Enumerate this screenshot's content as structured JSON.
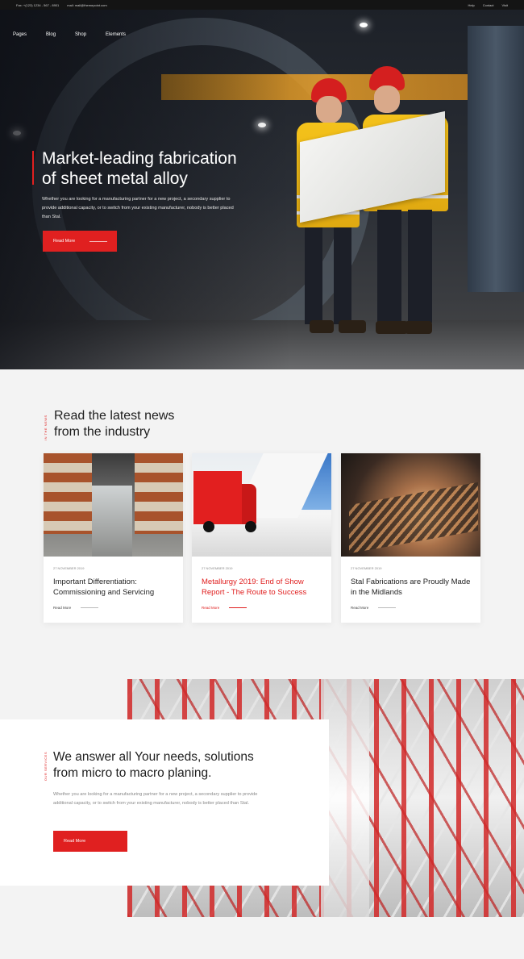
{
  "topbar": {
    "phone": "Fax: +(123) 1234 - 567 - 8901",
    "email": "mail: mail@themepoint.com",
    "links": [
      "Help",
      "Contact",
      "Visit"
    ]
  },
  "nav": [
    "Pages",
    "Blog",
    "Shop",
    "Elements"
  ],
  "hero": {
    "title_line1": "Market-leading fabrication",
    "title_line2": "of sheet metal alloy",
    "body": "Whether you are looking for a manufacturing partner for a new project, a secondary supplier to provide additional capacity, or to switch from your existing manufacturer, nobody is better placed than Stal.",
    "button": "Read More"
  },
  "news": {
    "label": "IN THE NEWS",
    "title_line1": "Read the latest news",
    "title_line2": "from the industry",
    "cards": [
      {
        "date": "27 NOVEMBER 2019",
        "title": "Important Differentiation: Commissioning and Servicing",
        "more": "Read More"
      },
      {
        "date": "27 NOVEMBER 2019",
        "title": "Metallurgy 2019: End of Show Report - The Route to Success",
        "more": "Read More"
      },
      {
        "date": "27 NOVEMBER 2019",
        "title": "Stal Fabrications are Proudly Made in the Midlands",
        "more": "Read More"
      }
    ]
  },
  "answer": {
    "label": "OUR SERVICES",
    "title_line1": "We answer all Your needs, solutions",
    "title_line2": "from micro to macro planing.",
    "body": "Whether you are looking for a manufacturing partner for a new project, a secondary supplier to provide additional capacity, or to switch from your existing manufacturer, nobody is better placed than Stal.",
    "button": "Read More"
  },
  "colors": {
    "accent": "#e02020",
    "dark": "#141414",
    "section_bg": "#f3f3f3"
  }
}
